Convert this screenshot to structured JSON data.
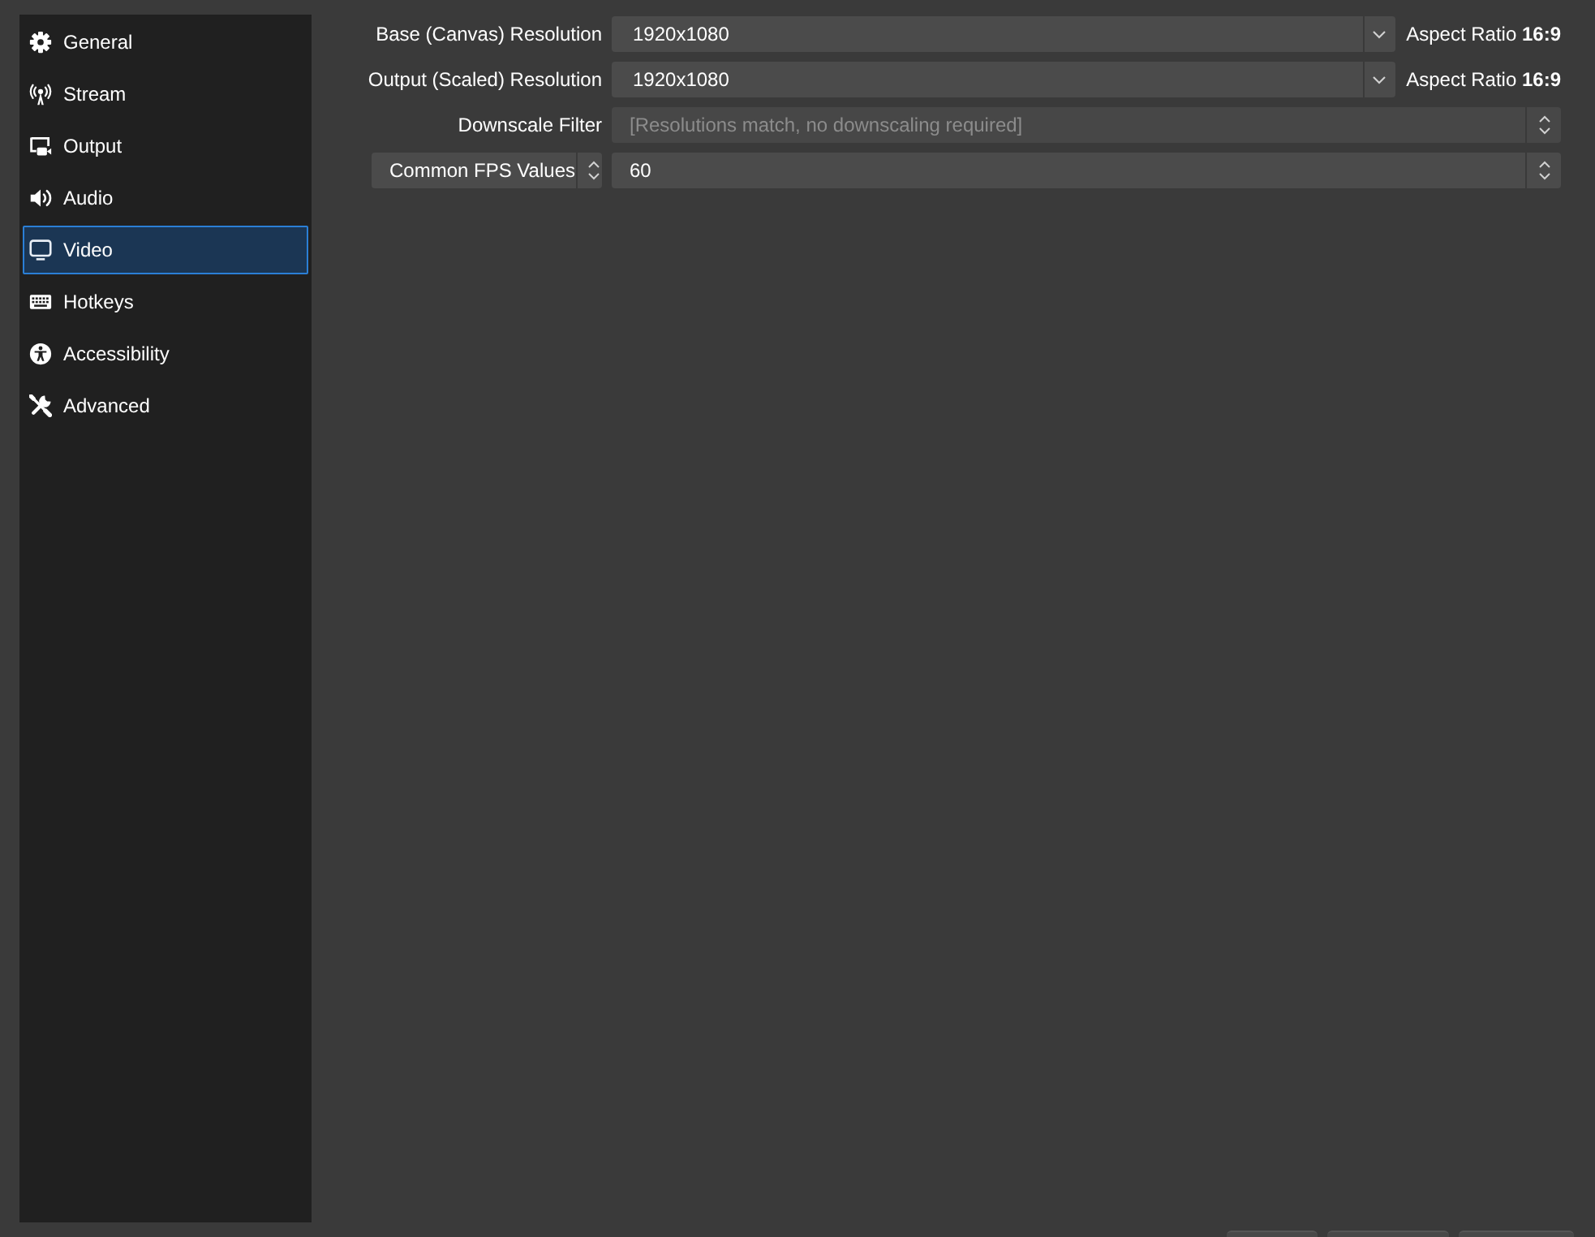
{
  "sidebar": {
    "items": [
      {
        "label": "General",
        "selected": false
      },
      {
        "label": "Stream",
        "selected": false
      },
      {
        "label": "Output",
        "selected": false
      },
      {
        "label": "Audio",
        "selected": false
      },
      {
        "label": "Video",
        "selected": true
      },
      {
        "label": "Hotkeys",
        "selected": false
      },
      {
        "label": "Accessibility",
        "selected": false
      },
      {
        "label": "Advanced",
        "selected": false
      }
    ]
  },
  "video_settings": {
    "rows": [
      {
        "label": {
          "kind": "text",
          "text": "Base (Canvas) Resolution"
        },
        "field": {
          "kind": "combo",
          "value": "1920x1080",
          "disabled": false
        },
        "note": "Aspect Ratio **16:9**"
      },
      {
        "label": {
          "kind": "text",
          "text": "Output (Scaled) Resolution"
        },
        "field": {
          "kind": "combo",
          "value": "1920x1080",
          "disabled": false
        },
        "note": "Aspect Ratio **16:9**"
      },
      {
        "label": {
          "kind": "text",
          "text": "Downscale Filter"
        },
        "field": {
          "kind": "select",
          "value": "[Resolutions match, no downscaling required]",
          "disabled": true
        }
      },
      {
        "label": {
          "kind": "select",
          "text": "Common FPS Values"
        },
        "field": {
          "kind": "select",
          "value": "60",
          "disabled": false
        }
      }
    ]
  }
}
